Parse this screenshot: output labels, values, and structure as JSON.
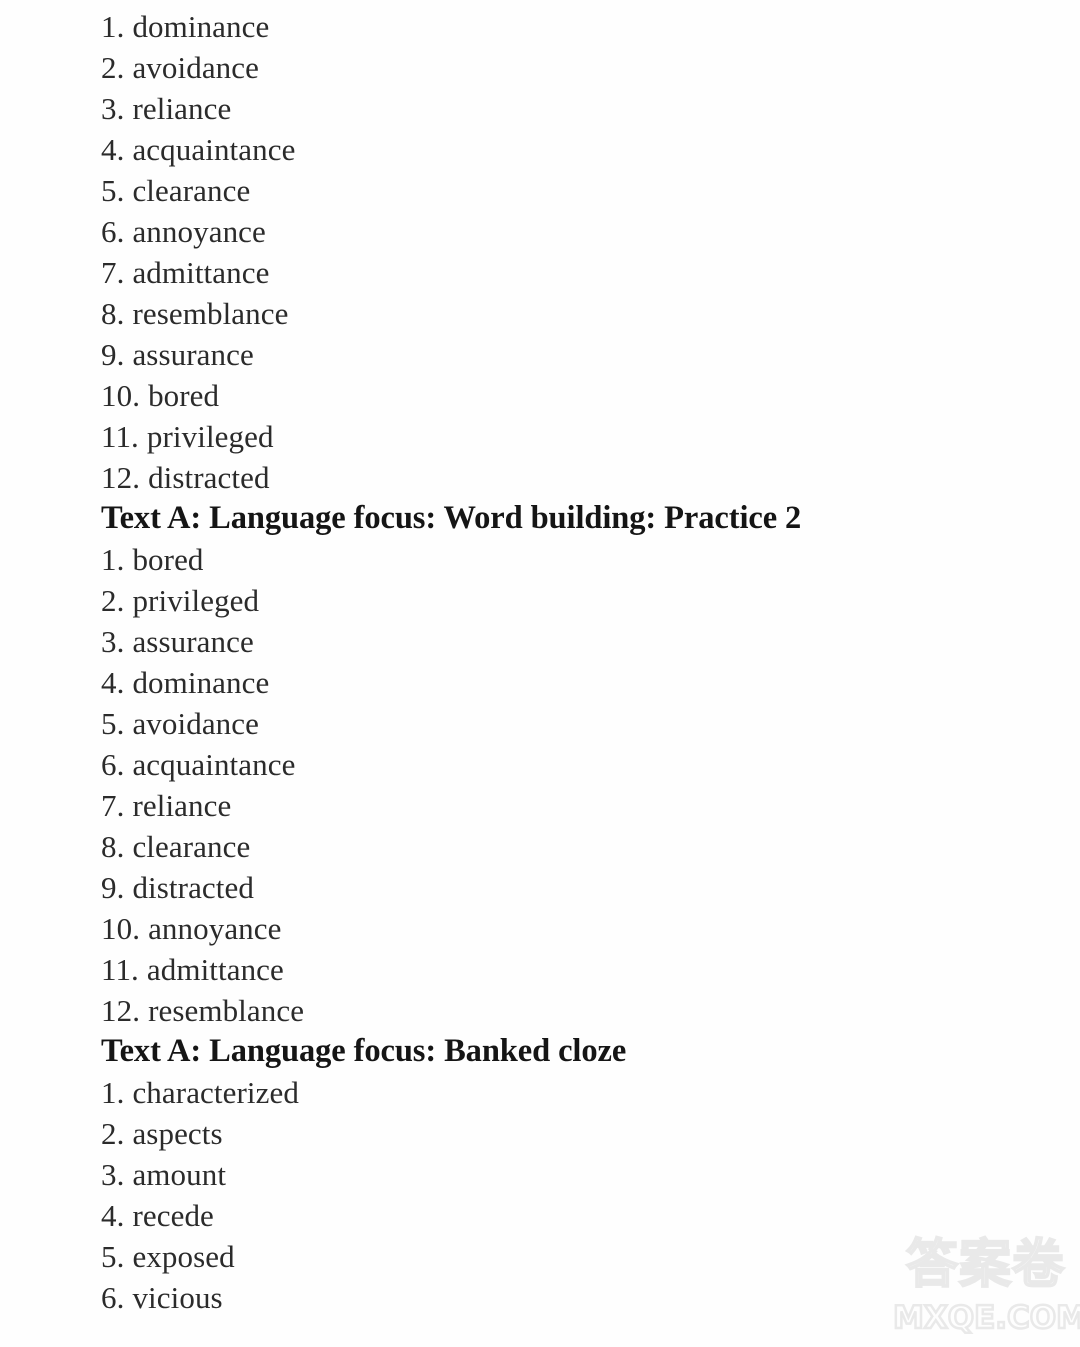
{
  "document": {
    "type": "answer-key",
    "sections": [
      {
        "heading": null,
        "items": [
          {
            "num": "1.",
            "text": "dominance"
          },
          {
            "num": "2.",
            "text": "avoidance"
          },
          {
            "num": "3.",
            "text": "reliance"
          },
          {
            "num": "4.",
            "text": "acquaintance"
          },
          {
            "num": "5.",
            "text": "clearance"
          },
          {
            "num": "6.",
            "text": "annoyance"
          },
          {
            "num": "7.",
            "text": "admittance"
          },
          {
            "num": "8.",
            "text": "resemblance"
          },
          {
            "num": "9.",
            "text": "assurance"
          },
          {
            "num": "10.",
            "text": "bored"
          },
          {
            "num": "11.",
            "text": "privileged"
          },
          {
            "num": "12.",
            "text": "distracted"
          }
        ]
      },
      {
        "heading": "Text A: Language focus: Word building: Practice 2",
        "items": [
          {
            "num": "1.",
            "text": "bored"
          },
          {
            "num": "2.",
            "text": "privileged"
          },
          {
            "num": "3.",
            "text": "assurance"
          },
          {
            "num": "4.",
            "text": "dominance"
          },
          {
            "num": "5.",
            "text": "avoidance"
          },
          {
            "num": "6.",
            "text": "acquaintance"
          },
          {
            "num": "7.",
            "text": "reliance"
          },
          {
            "num": "8.",
            "text": "clearance"
          },
          {
            "num": "9.",
            "text": "distracted"
          },
          {
            "num": "10.",
            "text": "annoyance"
          },
          {
            "num": "11.",
            "text": "admittance"
          },
          {
            "num": "12.",
            "text": "resemblance"
          }
        ]
      },
      {
        "heading": "Text A: Language focus: Banked cloze",
        "items": [
          {
            "num": "1.",
            "text": "characterized"
          },
          {
            "num": "2.",
            "text": "aspects"
          },
          {
            "num": "3.",
            "text": "amount"
          },
          {
            "num": "4.",
            "text": "recede"
          },
          {
            "num": "5.",
            "text": "exposed"
          },
          {
            "num": "6.",
            "text": "vicious"
          }
        ]
      }
    ]
  },
  "watermark": {
    "cjk": "答案卷",
    "url": "MXQE.COM",
    "color": "#e9e9e9"
  }
}
